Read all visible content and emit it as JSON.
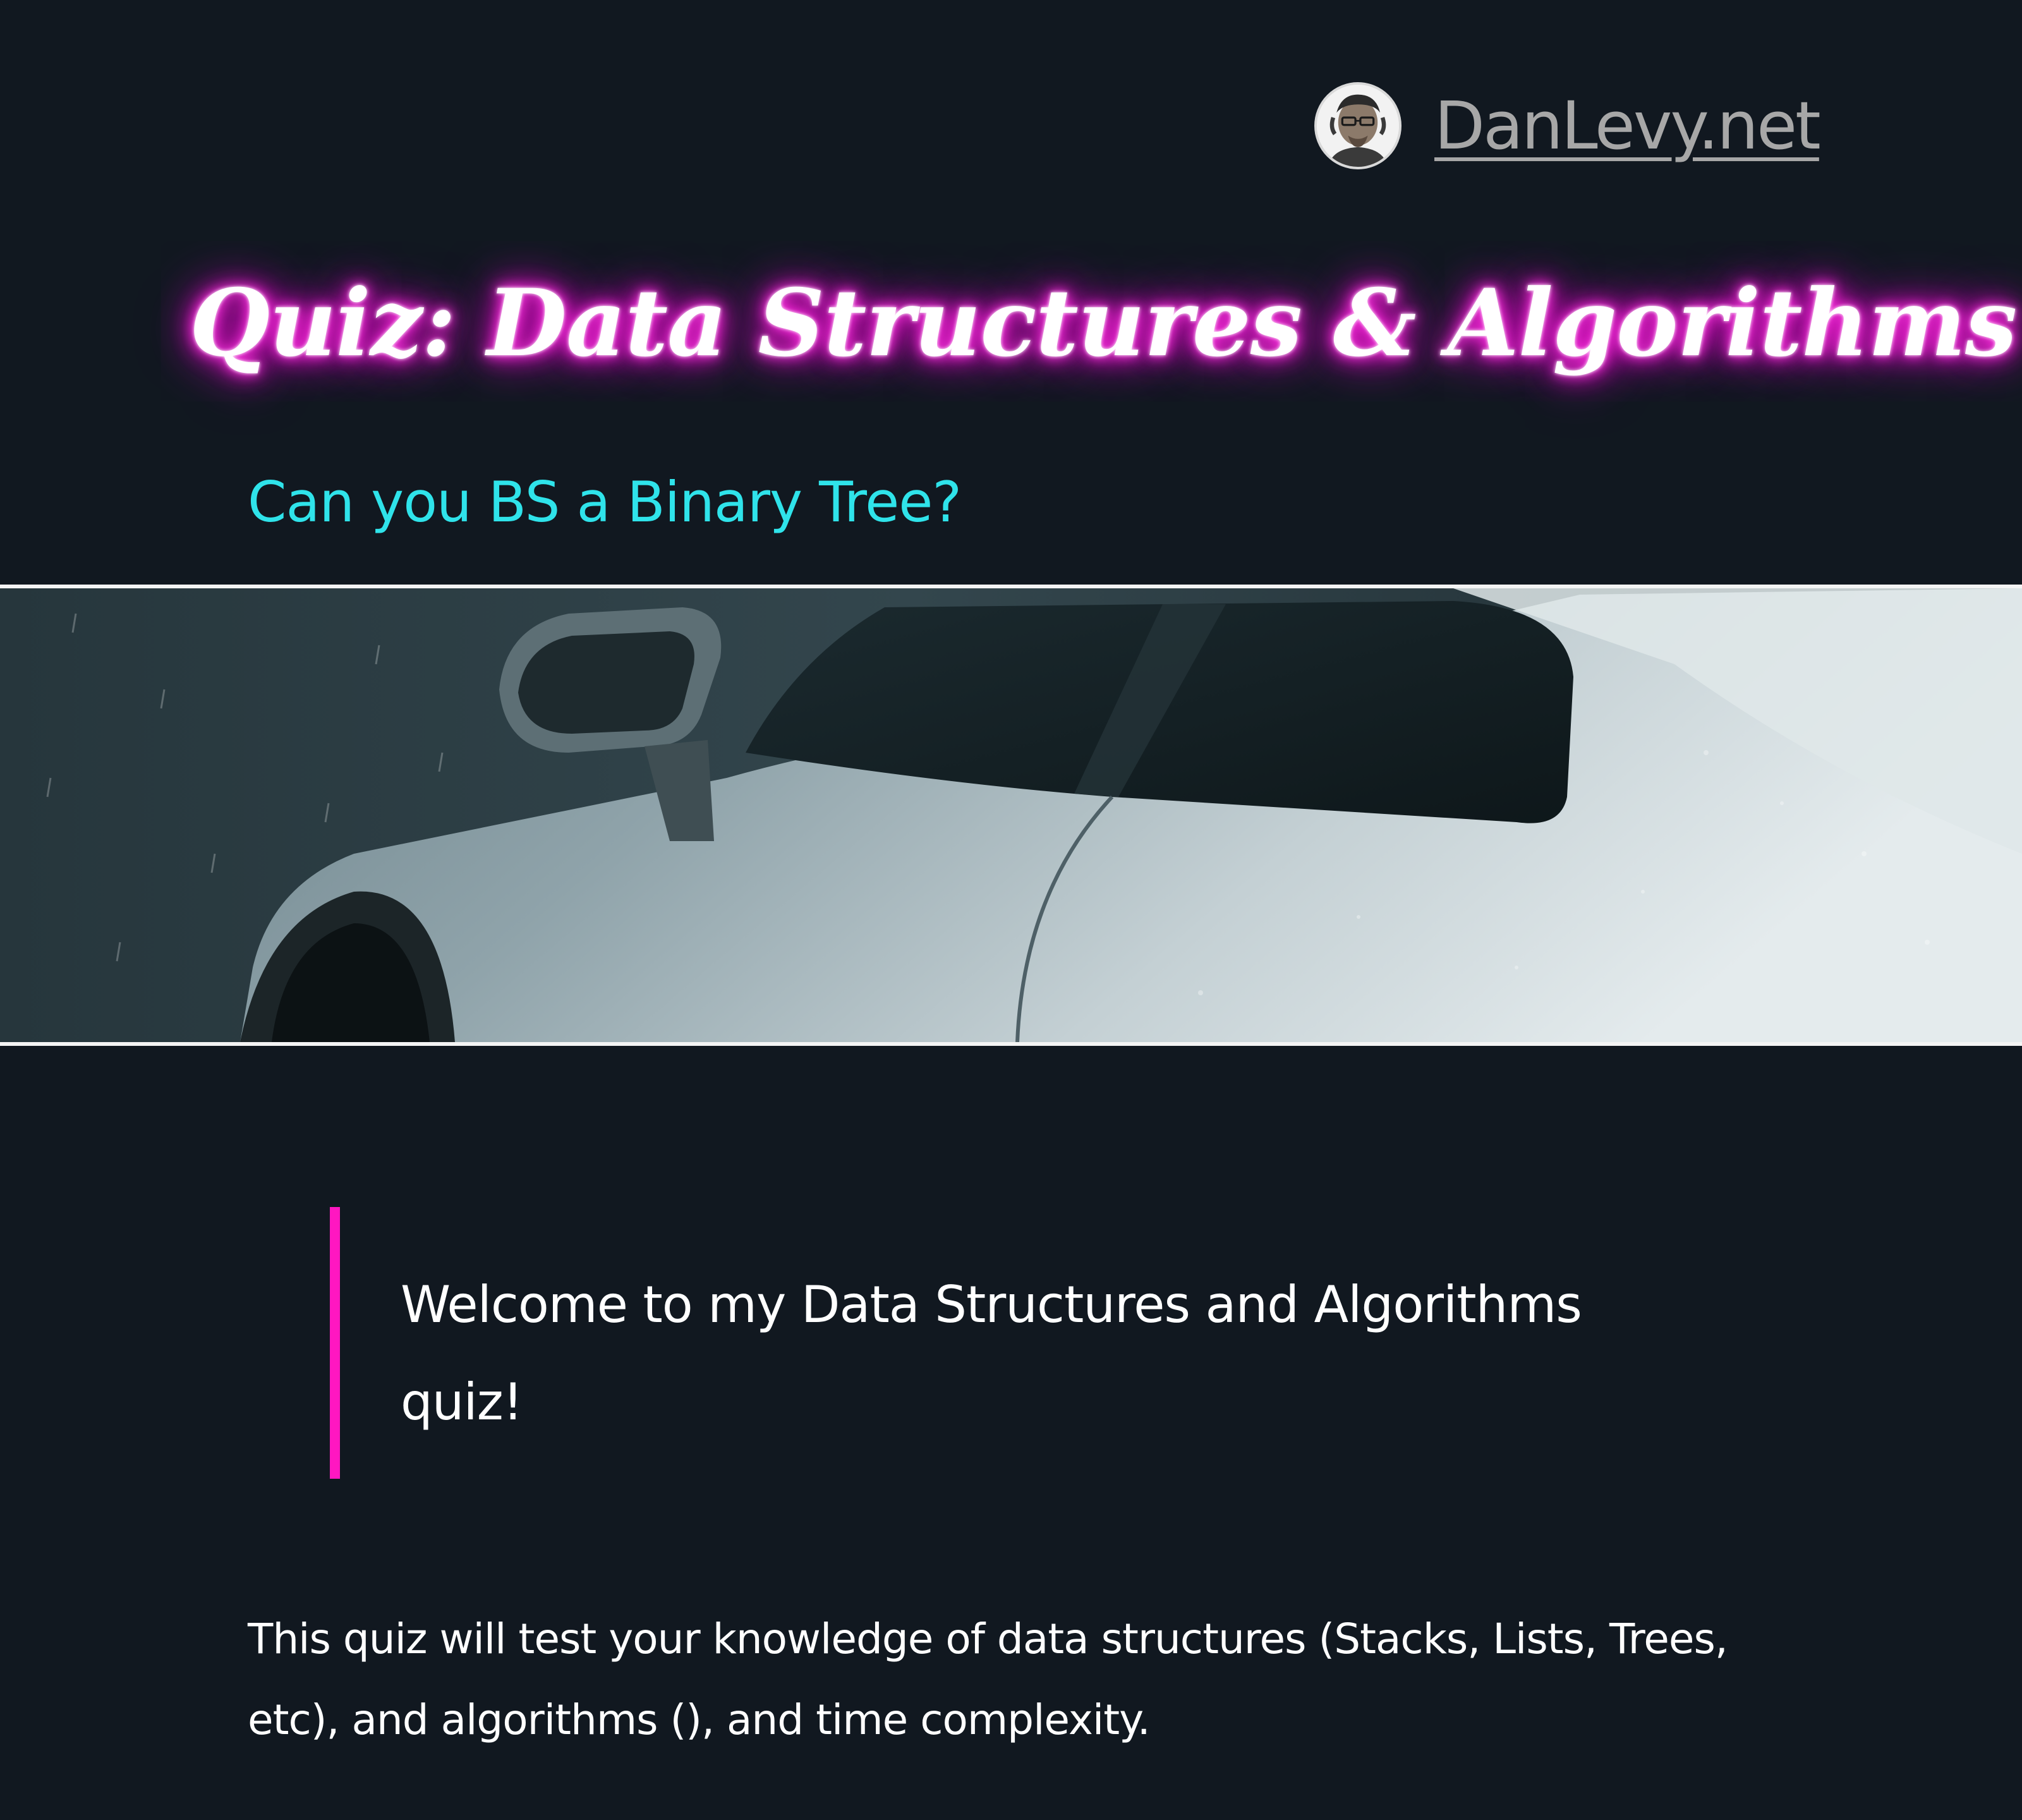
{
  "site": {
    "name": "DanLevy.net",
    "avatar_icon": "author-avatar"
  },
  "header": {
    "title": "Quiz: Data Structures & Algorithms",
    "subtitle": "Can you BS a Binary Tree?"
  },
  "banner": {
    "subject": "car-in-rain-photo"
  },
  "content": {
    "welcome": "Welcome to my Data Structures and Algorithms quiz!",
    "intro": "This quiz will test your knowledge of data structures (Stacks, Lists, Trees, etc), and algorithms (), and time complexity."
  },
  "colors": {
    "background": "#111820",
    "title_glow": "#ff1fd8",
    "subtitle": "#2fe3ea",
    "quote_border": "#ff17c1",
    "brand_link": "#a7a7a7"
  }
}
